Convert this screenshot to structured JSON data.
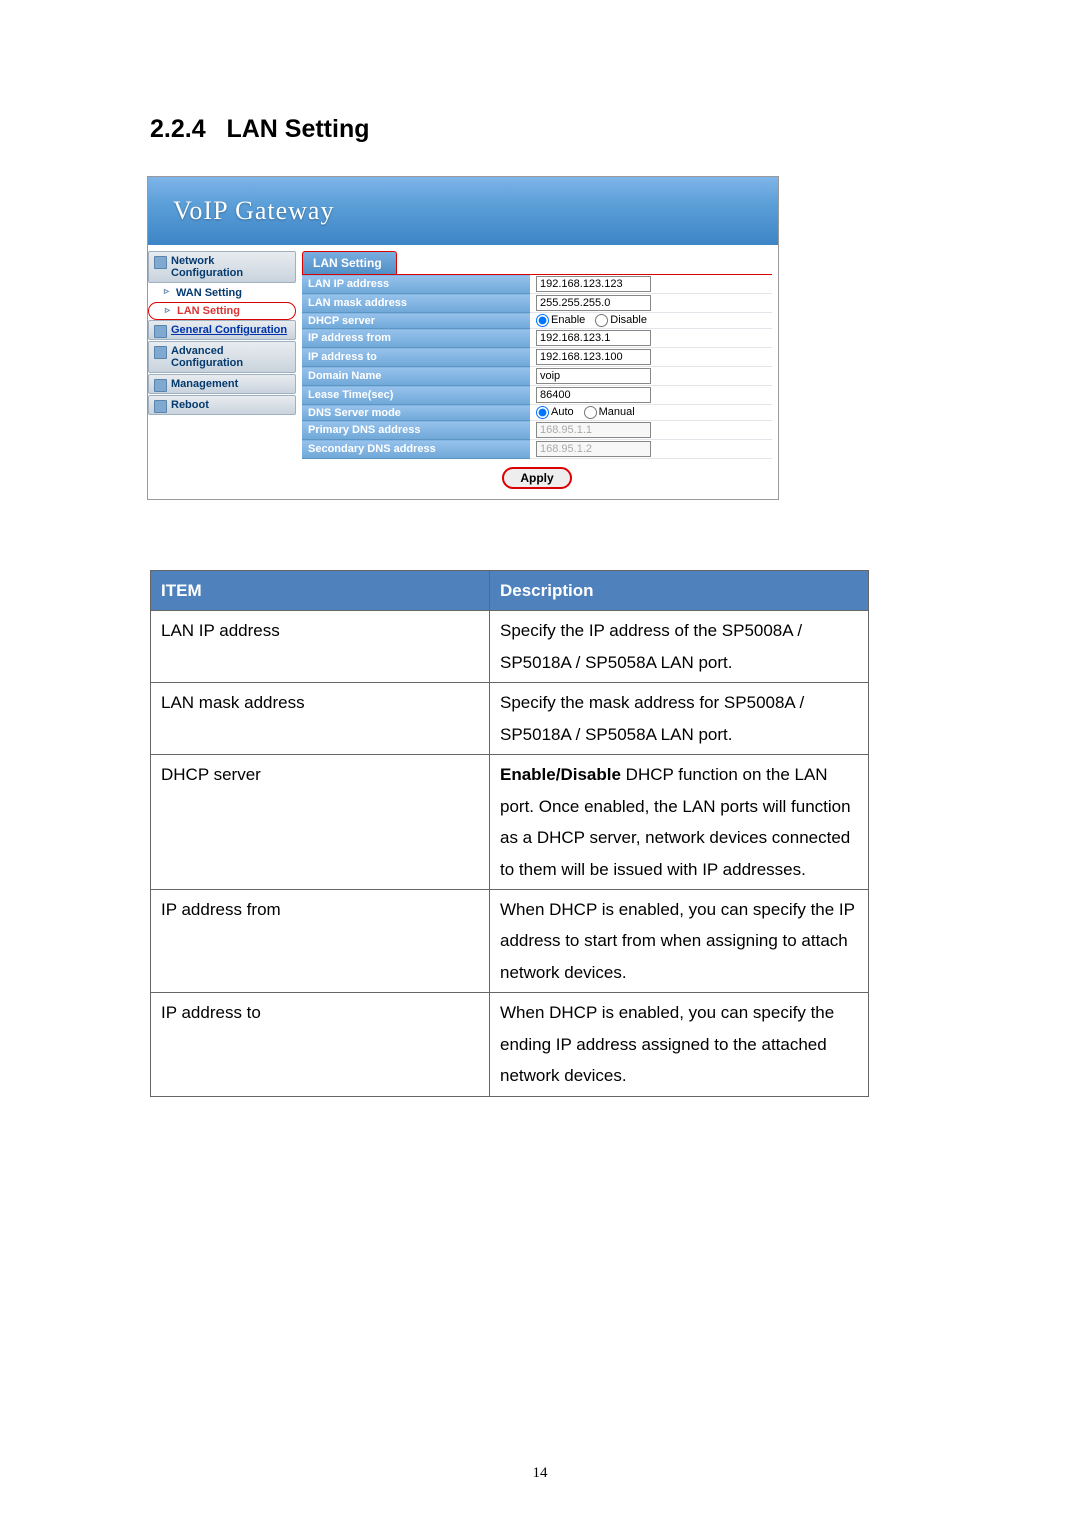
{
  "section_number": "2.2.4",
  "section_title": "LAN Setting",
  "page_number": "14",
  "ui": {
    "logo": "VoIP  Gateway",
    "sidebar": {
      "network_config": "Network Configuration",
      "wan_setting": "WAN Setting",
      "lan_setting": "LAN Setting",
      "general_config": "General Configuration",
      "adv_config": "Advanced Configuration",
      "management": "Management",
      "reboot": "Reboot"
    },
    "panel_title": "LAN Setting",
    "rows": [
      {
        "label": "LAN IP address",
        "value": "192.168.123.123",
        "type": "text"
      },
      {
        "label": "LAN mask address",
        "value": "255.255.255.0",
        "type": "text"
      },
      {
        "label": "DHCP server",
        "type": "radio",
        "opt1": "Enable",
        "opt2": "Disable"
      },
      {
        "label": "IP address from",
        "value": "192.168.123.1",
        "type": "text"
      },
      {
        "label": "IP address to",
        "value": "192.168.123.100",
        "type": "text"
      },
      {
        "label": "Domain Name",
        "value": "voip",
        "type": "text"
      },
      {
        "label": "Lease Time(sec)",
        "value": "86400",
        "type": "text"
      },
      {
        "label": "DNS Server  mode",
        "type": "radio",
        "opt1": "Auto",
        "opt2": "Manual"
      },
      {
        "label": "Primary DNS address",
        "value": "168.95.1.1",
        "type": "text",
        "disabled": true
      },
      {
        "label": "Secondary DNS address",
        "value": "168.95.1.2",
        "type": "text",
        "disabled": true
      }
    ],
    "apply_label": "Apply"
  },
  "desc_table": {
    "header_item": "ITEM",
    "header_desc": "Description",
    "rows": [
      {
        "item": "LAN IP address",
        "desc": "Specify the IP address of the SP5008A / SP5018A / SP5058A LAN port."
      },
      {
        "item": "LAN mask address",
        "desc": "Specify the mask address for SP5008A / SP5018A / SP5058A LAN port."
      },
      {
        "item": "DHCP server",
        "desc_bold": "Enable/Disable",
        "desc_rest": " DHCP function on the LAN port. Once enabled, the LAN ports will function as a DHCP server, network devices connected to them will be issued with IP addresses."
      },
      {
        "item": "IP address from",
        "desc": "When DHCP is enabled, you can specify the IP address to start from when assigning to attach network devices."
      },
      {
        "item": "IP address to",
        "desc": "When DHCP is enabled, you can specify the ending IP address assigned to the attached network devices."
      }
    ]
  }
}
